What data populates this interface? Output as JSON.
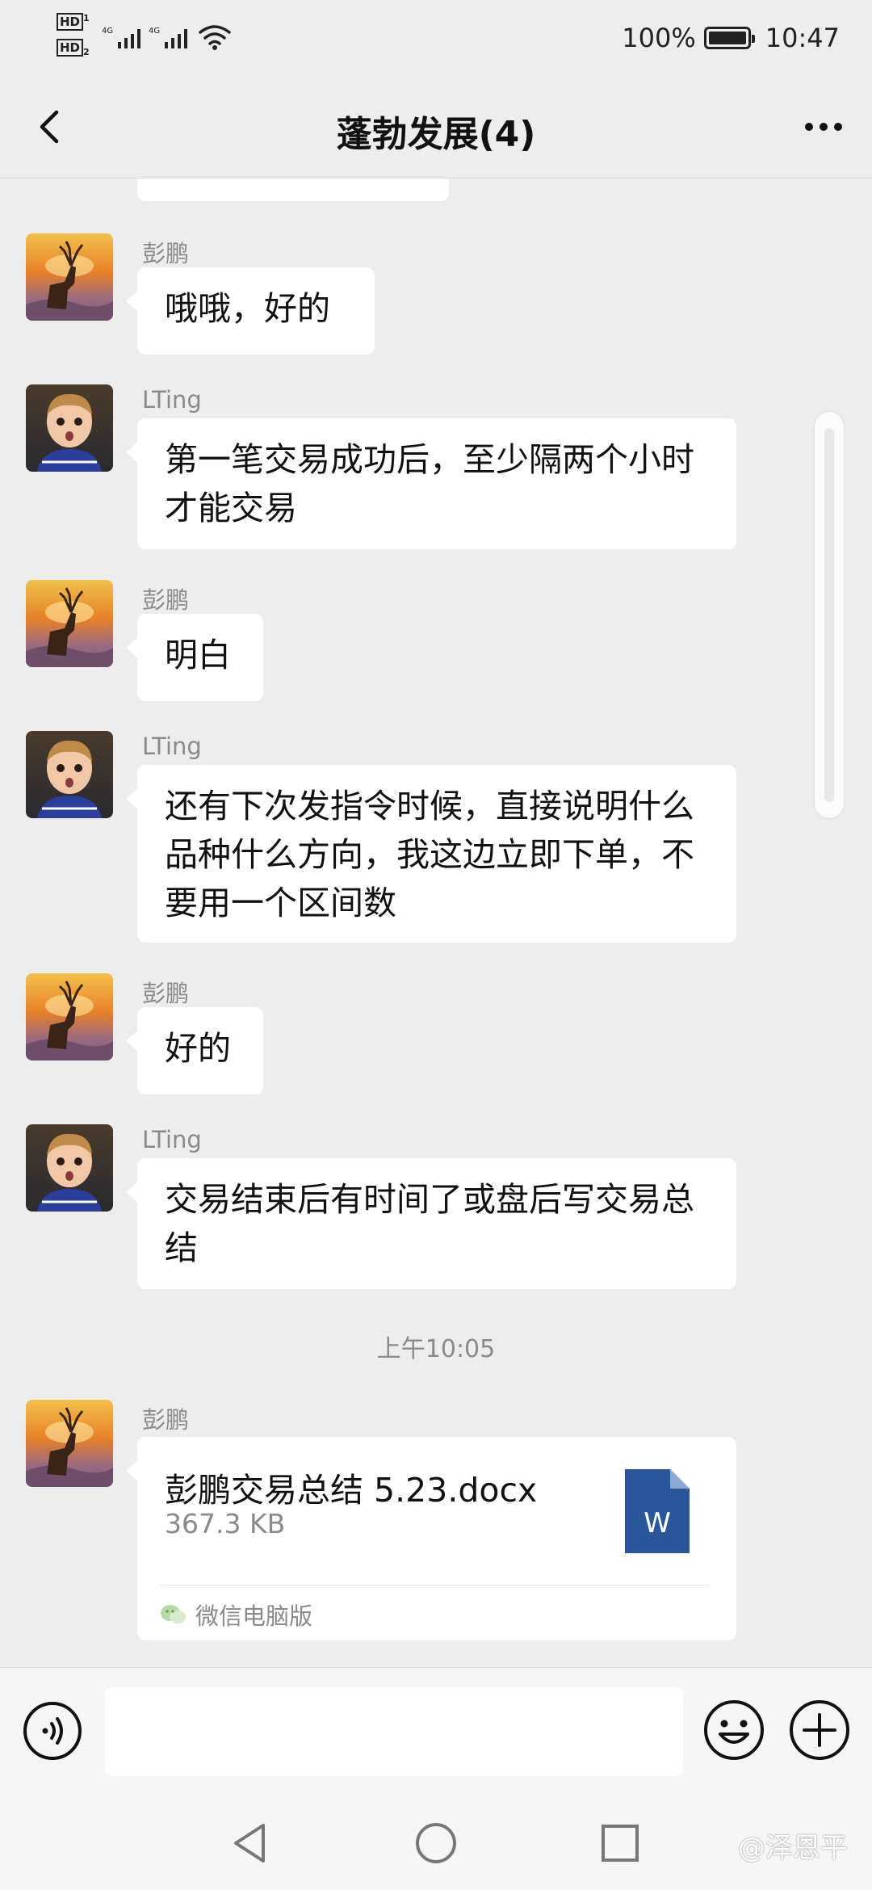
{
  "status_bar": {
    "hd1": "HD",
    "hd2": "HD",
    "network1": "4G",
    "network2": "4G",
    "battery_percent": "100%",
    "time": "10:47"
  },
  "nav": {
    "title": "蓬勃发展(4)",
    "back_icon": "chevron-left-icon",
    "more_icon": "more-icon"
  },
  "messages": [
    {
      "sender": "彭鹏",
      "text": "哦哦，好的",
      "avatar": "deer-avatar"
    },
    {
      "sender": "LTing",
      "text": "第一笔交易成功后，至少隔两个小时才能交易",
      "avatar": "child-avatar"
    },
    {
      "sender": "彭鹏",
      "text": "明白",
      "avatar": "deer-avatar"
    },
    {
      "sender": "LTing",
      "text": "还有下次发指令时候，直接说明什么品种什么方向，我这边立即下单，不要用一个区间数",
      "avatar": "child-avatar"
    },
    {
      "sender": "彭鹏",
      "text": "好的",
      "avatar": "deer-avatar"
    },
    {
      "sender": "LTing",
      "text": "交易结束后有时间了或盘后写交易总结",
      "avatar": "child-avatar"
    }
  ],
  "timestamp": "上午10:05",
  "file_message": {
    "sender": "彭鹏",
    "file_name": "彭鹏交易总结 5.23.docx",
    "file_size": "367.3 KB",
    "file_icon_letter": "W",
    "source": "微信电脑版"
  },
  "input_bar": {
    "placeholder": "",
    "voice_icon": "voice-icon",
    "emoji_icon": "emoji-icon",
    "plus_icon": "plus-icon"
  },
  "watermark": "@泽恩平",
  "colors": {
    "background": "#ededed",
    "bubble": "#ffffff",
    "word_icon": "#2b579a",
    "secondary_text": "#8a8a8a"
  }
}
